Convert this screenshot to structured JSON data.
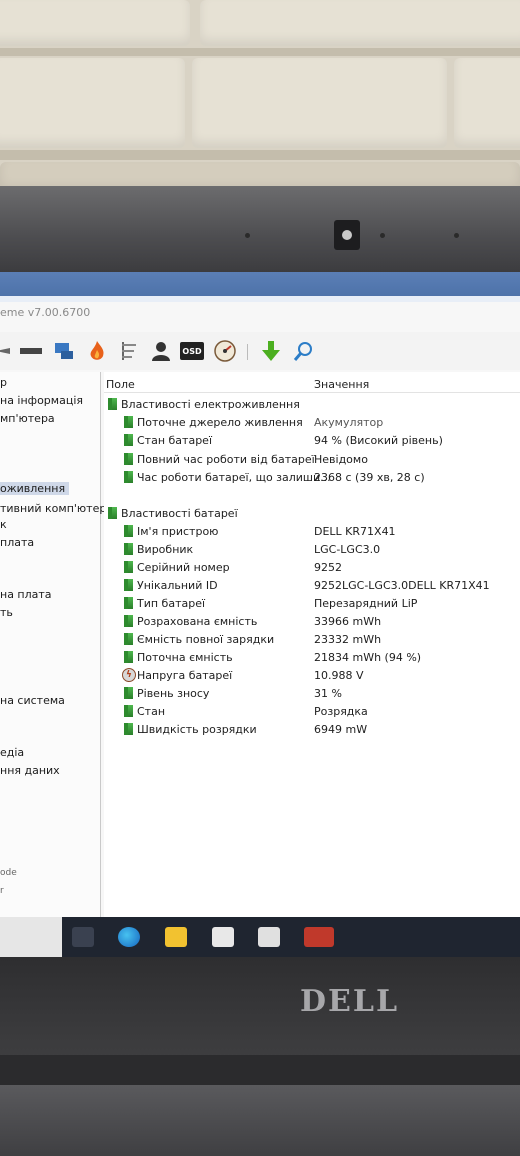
{
  "window": {
    "title_fragment": "eme v7.00.6700"
  },
  "toolbar": {
    "icons": [
      "arrow-icon",
      "monitor-strip-icon",
      "network-icon",
      "flame-icon",
      "tools-icon",
      "user-icon",
      "osd-icon",
      "gauge-icon",
      "download-arrow-icon",
      "search-icon"
    ],
    "osd_label": "OSD"
  },
  "nav": {
    "items": [
      "р",
      "на інформація",
      "мп'ютера",
      "оживлення",
      "тивний комп'ютер",
      "к",
      " плата",
      "на плата",
      "ть",
      "на система",
      "едіа",
      "ння даних",
      "ode",
      "r"
    ]
  },
  "table": {
    "col_field": "Поле",
    "col_value": "Значення",
    "group1": "Властивості електроживлення",
    "rows1": [
      {
        "label": "Поточне джерело живлення",
        "value": "Акумулятор"
      },
      {
        "label": "Стан батареї",
        "value": "94 % (Високий рівень)"
      },
      {
        "label": "Повний час роботи від батареї",
        "value": "Невідомо"
      },
      {
        "label": "Час роботи батареї, що залиши...",
        "value": "2368 с (39 хв, 28 с)"
      }
    ],
    "group2": "Властивості батареї",
    "rows2": [
      {
        "label": "Ім'я пристрою",
        "value": "DELL KR71X41"
      },
      {
        "label": "Виробник",
        "value": "LGC-LGC3.0"
      },
      {
        "label": "Серійний номер",
        "value": "9252"
      },
      {
        "label": "Унікальний ID",
        "value": "9252LGC-LGC3.0DELL KR71X41"
      },
      {
        "label": "Тип батареї",
        "value": "Перезарядний LiP"
      },
      {
        "label": "Розрахована ємність",
        "value": "33966 mWh"
      },
      {
        "label": "Ємність повної зарядки",
        "value": "23332 mWh"
      },
      {
        "label": "Поточна ємність",
        "value": "21834 mWh  (94 %)"
      },
      {
        "label": "Напруга батареї",
        "value": "10.988 V"
      },
      {
        "label": "Рівень зносу",
        "value": "31 %"
      },
      {
        "label": "Стан",
        "value": "Розрядка"
      },
      {
        "label": "Швидкість розрядки",
        "value": "6949 mW"
      }
    ]
  },
  "taskbar": {
    "icons": [
      "windows-start-icon",
      "edge-icon",
      "file-explorer-icon",
      "store-icon",
      "mail-icon",
      "aida64-icon"
    ]
  },
  "laptop": {
    "brand": "DELL"
  }
}
